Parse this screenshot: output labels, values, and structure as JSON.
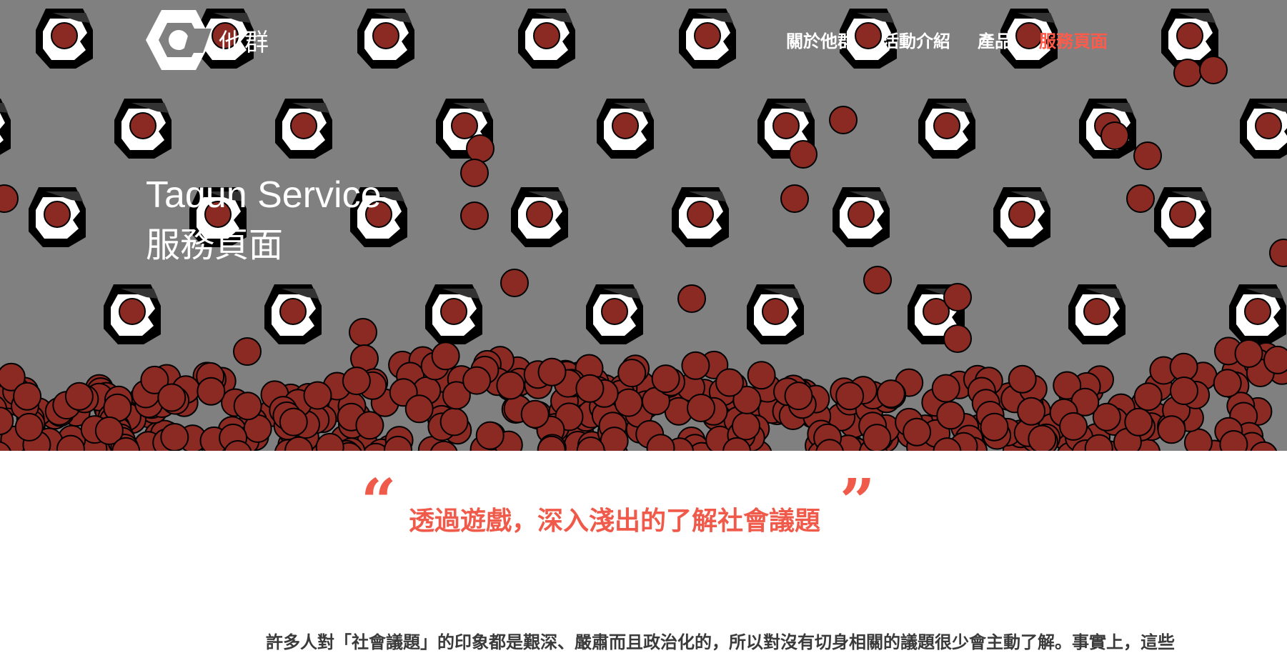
{
  "brand": {
    "name": "他群",
    "logo_icon": "taqun-logo-icon"
  },
  "nav": {
    "items": [
      {
        "label": "關於他群",
        "active": false
      },
      {
        "label": "活動介紹",
        "active": false
      },
      {
        "label": "產品",
        "active": false
      },
      {
        "label": "服務頁面",
        "active": true
      }
    ]
  },
  "hero": {
    "title_en": "Taqun Service",
    "title_zh": "服務頁面",
    "background": "falling-dots-pattern",
    "colors": {
      "background": "#808080",
      "ball": "#8b2a22",
      "accent": "#ff5a4a"
    }
  },
  "quote": {
    "open_mark": "“",
    "text": "透過遊戲，深入淺出的了解社會議題",
    "close_mark": "”"
  },
  "intro": {
    "text": "許多人對「社會議題」的印象都是艱深、嚴肅而且政治化的，所以對沒有切身相關的議題很少會主動了解。事實上，這些"
  }
}
